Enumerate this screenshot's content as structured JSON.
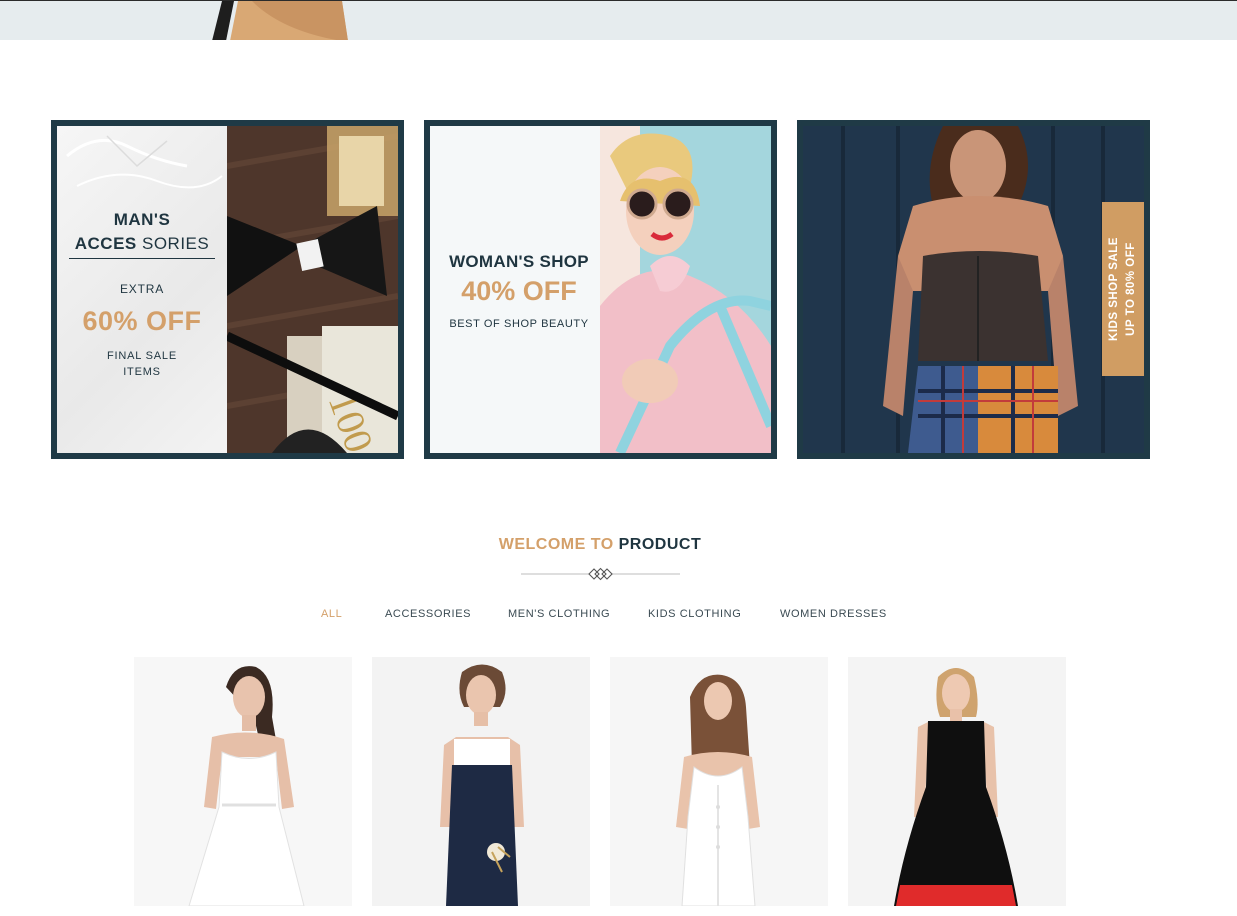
{
  "banners": [
    {
      "id": "mens",
      "title_bold_1": "MAN'S",
      "title_bold_2": "ACCES",
      "title_thin": " SORIES",
      "extra": "EXTRA",
      "discount": "60% OFF",
      "final_line_1": "FINAL SALE",
      "final_line_2": "ITEMS"
    },
    {
      "id": "womens",
      "title": "WOMAN'S SHOP",
      "discount": "40% OFF",
      "subtitle": "BEST OF SHOP BEAUTY"
    },
    {
      "id": "kids",
      "tag_line_1": "KIDS SHOP SALE",
      "tag_line_2": "UP TO 80% OFF"
    }
  ],
  "products_section": {
    "title_accent": "WELCOME TO",
    "title_dark": "PRODUCT"
  },
  "filters": [
    {
      "label": "ALL",
      "active": true
    },
    {
      "label": "ACCESSORIES",
      "active": false
    },
    {
      "label": "MEN'S CLOTHING",
      "active": false
    },
    {
      "label": "KIDS CLOTHING",
      "active": false
    },
    {
      "label": "WOMEN DRESSES",
      "active": false
    }
  ],
  "colors": {
    "accent": "#d4a06a",
    "dark": "#1f3540",
    "banner_border": "#1f3a46",
    "tag": "#d09d63"
  }
}
